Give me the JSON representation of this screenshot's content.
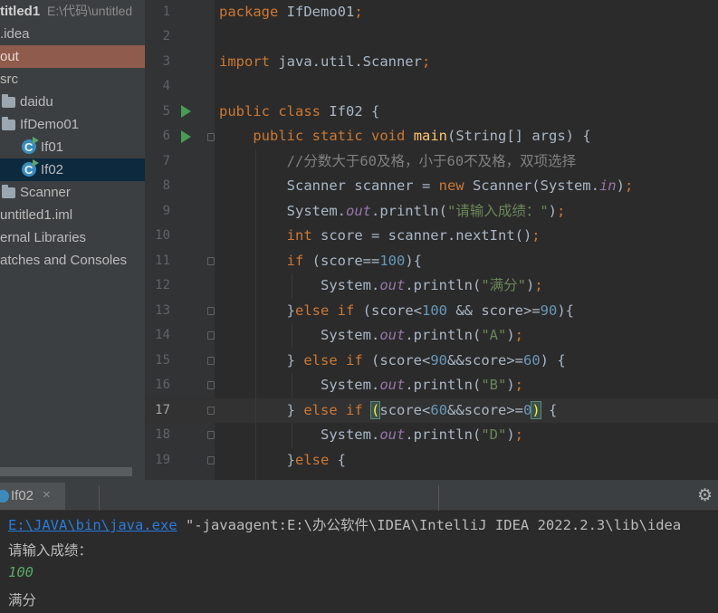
{
  "project_tree": {
    "root_name": "titled1",
    "root_path": "E:\\代码\\untitled",
    "items": [
      {
        "label": ".idea"
      },
      {
        "label": "out"
      },
      {
        "label": "src"
      },
      {
        "label": "daidu"
      },
      {
        "label": "IfDemo01"
      },
      {
        "label": "If01"
      },
      {
        "label": "If02"
      },
      {
        "label": "Scanner"
      },
      {
        "label": "untitled1.iml"
      },
      {
        "label": "ernal Libraries"
      },
      {
        "label": "atches and Consoles"
      }
    ]
  },
  "editor": {
    "line_numbers": [
      "1",
      "2",
      "3",
      "4",
      "5",
      "6",
      "7",
      "8",
      "9",
      "10",
      "11",
      "12",
      "13",
      "14",
      "15",
      "16",
      "17",
      "18",
      "19"
    ],
    "current_line": "17",
    "lines": [
      "package IfDemo01;",
      "",
      "import java.util.Scanner;",
      "",
      "public class If02 {",
      "    public static void main(String[] args) {",
      "        //分数大于60及格，小于60不及格，双项选择",
      "        Scanner scanner = new Scanner(System.in);",
      "        System.out.println(\"请输入成绩：\");",
      "        int score = scanner.nextInt();",
      "        if (score==100){",
      "            System.out.println(\"满分\");",
      "        }else if (score<100 && score>=90){",
      "            System.out.println(\"A\");",
      "        } else if (score<90&&score>=60) {",
      "            System.out.println(\"B\");",
      "        } else if (score<60&&score>=0) {",
      "            System.out.println(\"D\");",
      "        }else {"
    ]
  },
  "run_panel": {
    "tab_label": "If02",
    "close_glyph": "×",
    "settings_icon": "gear-icon",
    "console": {
      "java_exe": "E:\\JAVA\\bin\\java.exe",
      "command_rest": " \"-javaagent:E:\\办公软件\\IDEA\\IntelliJ IDEA 2022.2.3\\lib\\idea",
      "prompt": "请输入成绩：",
      "user_input": "100",
      "output": "满分"
    }
  },
  "colors": {
    "keyword": "#cc7832",
    "string": "#6a8759",
    "number": "#6897bb",
    "method": "#ffc66d",
    "static_field": "#9876aa",
    "comment": "#808080",
    "selection_out": "#8f5b4d",
    "selection_if02": "#0d293e",
    "run_gutter": "#499c54"
  }
}
